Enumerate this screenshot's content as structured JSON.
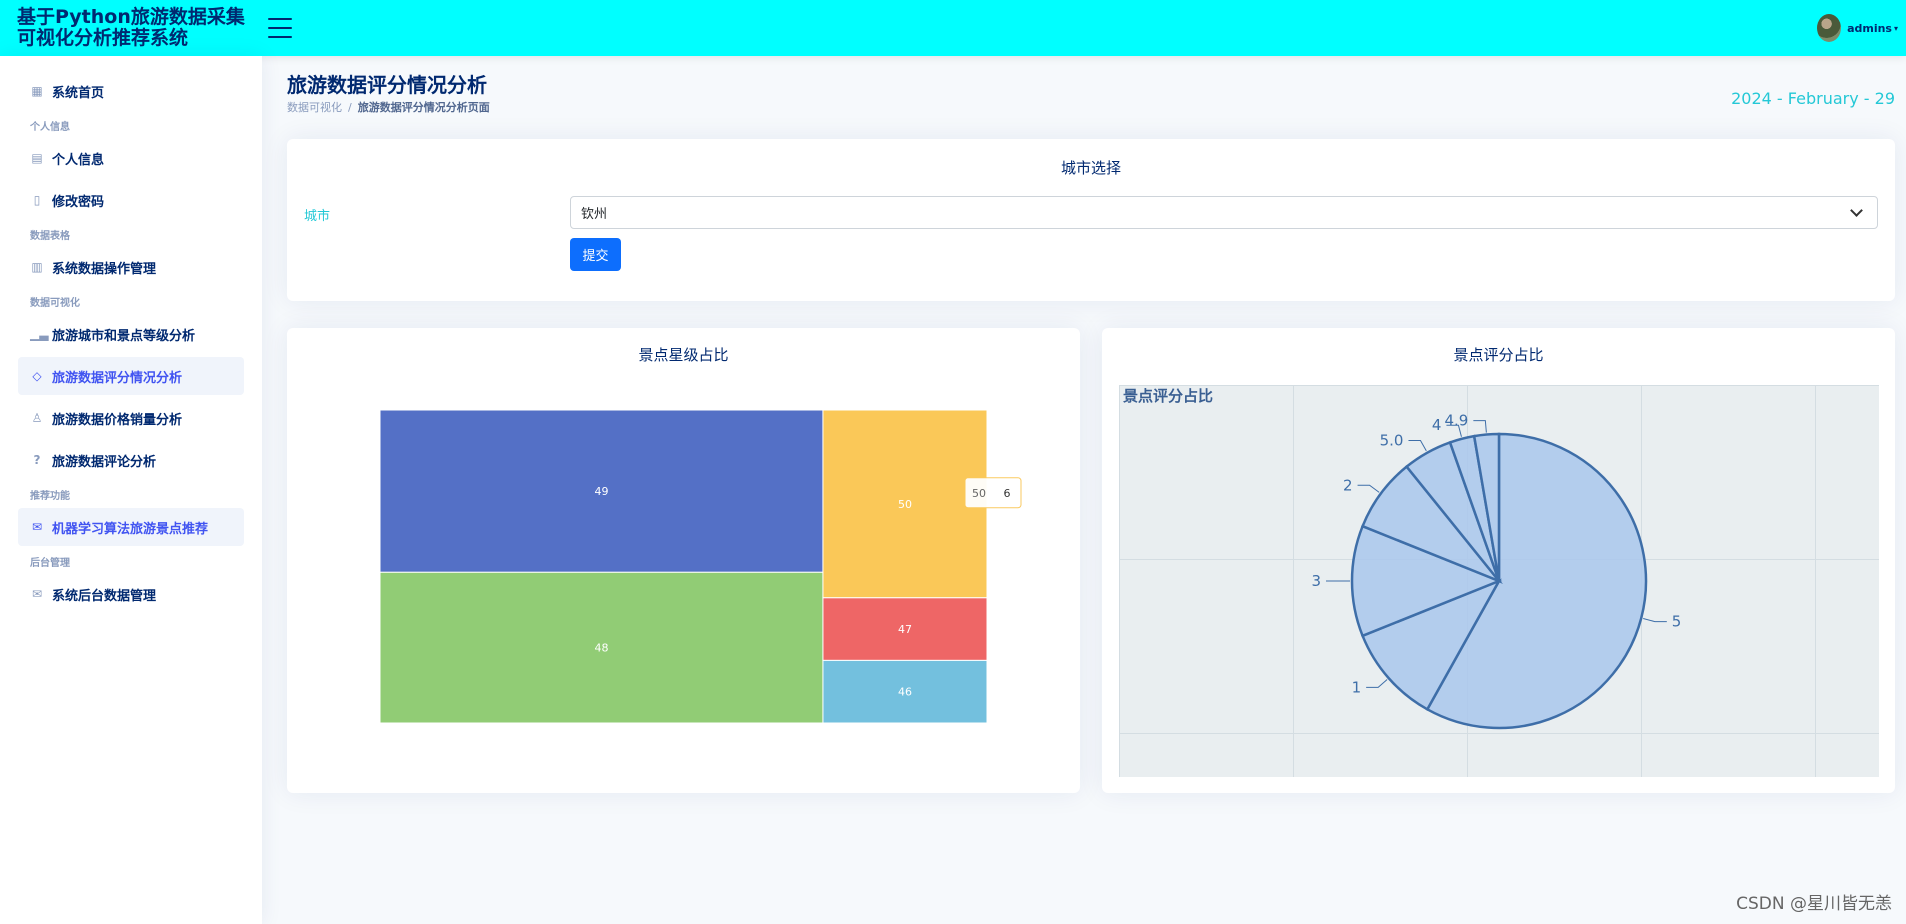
{
  "app": {
    "title": "基于Python旅游数据采集可视化分析推荐系统",
    "user": "admins"
  },
  "sidebar": {
    "home": "系统首页",
    "sec_personal": "个人信息",
    "profile": "个人信息",
    "password": "修改密码",
    "sec_tables": "数据表格",
    "data_ops": "系统数据操作管理",
    "sec_viz": "数据可视化",
    "city_level": "旅游城市和景点等级分析",
    "rating": "旅游数据评分情况分析",
    "price": "旅游数据价格销量分析",
    "comments": "旅游数据评论分析",
    "sec_rec": "推荐功能",
    "ml_rec": "机器学习算法旅游景点推荐",
    "sec_admin": "后台管理",
    "backend": "系统后台数据管理"
  },
  "page": {
    "title": "旅游数据评分情况分析",
    "crumb_parent": "数据可视化",
    "crumb_sep": "/",
    "crumb_current": "旅游数据评分情况分析页面",
    "date": "2024 - February - 29"
  },
  "city_card": {
    "title": "城市选择",
    "label": "城市",
    "selected": "钦州",
    "submit": "提交"
  },
  "chart_left": {
    "card_title": "景点星级占比",
    "tooltip_name": "50",
    "tooltip_value": "6"
  },
  "chart_right": {
    "card_title": "景点评分占比",
    "inner_title": "景点评分占比"
  },
  "chart_data": [
    {
      "type": "treemap",
      "title": "景点星级占比",
      "nodes": [
        {
          "name": "49",
          "value": 14,
          "color": "#5470c6"
        },
        {
          "name": "48",
          "value": 13,
          "color": "#91cc75"
        },
        {
          "name": "50",
          "value": 6,
          "color": "#fac858"
        },
        {
          "name": "47",
          "value": 2,
          "color": "#ee6666"
        },
        {
          "name": "46",
          "value": 2,
          "color": "#73c0de"
        }
      ]
    },
    {
      "type": "pie",
      "title": "景点评分占比",
      "slices": [
        {
          "name": "5",
          "value": 43
        },
        {
          "name": "1",
          "value": 8
        },
        {
          "name": "3",
          "value": 9
        },
        {
          "name": "2",
          "value": 6
        },
        {
          "name": "5.0",
          "value": 4
        },
        {
          "name": "4",
          "value": 2
        },
        {
          "name": "4.9",
          "value": 2
        }
      ]
    }
  ],
  "watermark": "CSDN @星川皆无恙"
}
